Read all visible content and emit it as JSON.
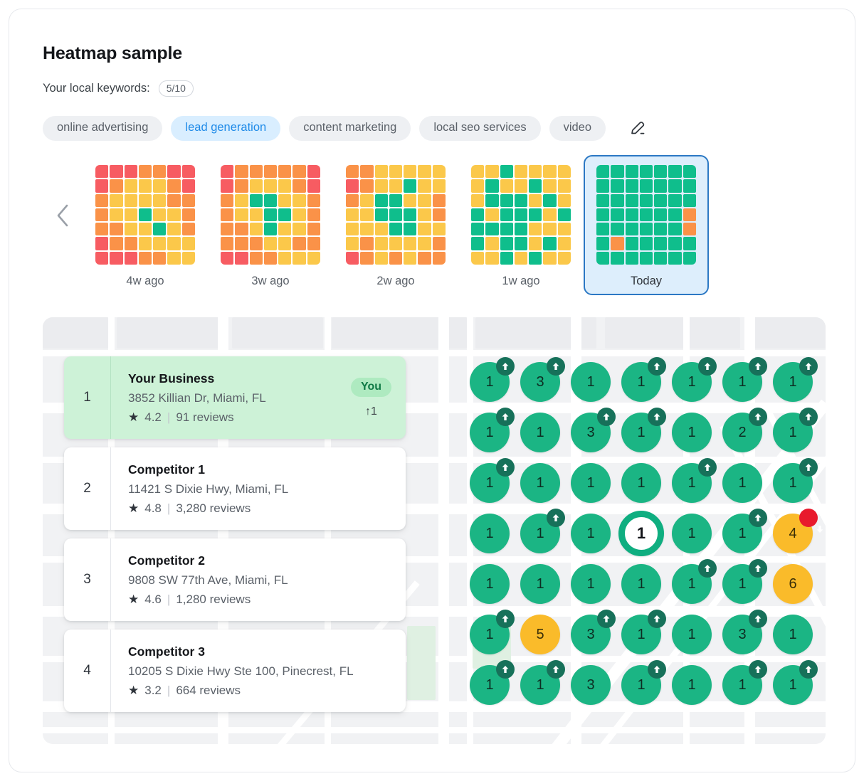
{
  "header": {
    "title": "Heatmap sample",
    "keywords_label": "Your local keywords:",
    "keywords_count": "5/10",
    "edit_icon": "pencil-icon"
  },
  "keywords": [
    {
      "label": "online advertising",
      "active": false
    },
    {
      "label": "lead generation",
      "active": true
    },
    {
      "label": "content marketing",
      "active": false
    },
    {
      "label": "local seo services",
      "active": false
    },
    {
      "label": "video",
      "active": false
    }
  ],
  "timeline": {
    "prev_icon": "chevron-left-icon",
    "snapshots": [
      {
        "label": "4w ago",
        "selected": false,
        "grid": [
          [
            "r",
            "r",
            "r",
            "o",
            "o",
            "r",
            "r"
          ],
          [
            "r",
            "o",
            "y",
            "y",
            "y",
            "o",
            "r"
          ],
          [
            "o",
            "y",
            "y",
            "y",
            "y",
            "o",
            "o"
          ],
          [
            "o",
            "y",
            "y",
            "g",
            "y",
            "y",
            "o"
          ],
          [
            "o",
            "o",
            "y",
            "y",
            "g",
            "y",
            "o"
          ],
          [
            "r",
            "o",
            "o",
            "y",
            "y",
            "y",
            "y"
          ],
          [
            "r",
            "r",
            "r",
            "o",
            "o",
            "y",
            "y"
          ]
        ]
      },
      {
        "label": "3w ago",
        "selected": false,
        "grid": [
          [
            "r",
            "o",
            "o",
            "o",
            "o",
            "o",
            "r"
          ],
          [
            "r",
            "o",
            "y",
            "y",
            "y",
            "o",
            "r"
          ],
          [
            "o",
            "y",
            "g",
            "g",
            "y",
            "y",
            "o"
          ],
          [
            "o",
            "y",
            "y",
            "g",
            "g",
            "y",
            "o"
          ],
          [
            "o",
            "o",
            "y",
            "g",
            "y",
            "y",
            "o"
          ],
          [
            "o",
            "o",
            "o",
            "y",
            "y",
            "o",
            "o"
          ],
          [
            "r",
            "r",
            "o",
            "o",
            "y",
            "y",
            "y"
          ]
        ]
      },
      {
        "label": "2w ago",
        "selected": false,
        "grid": [
          [
            "o",
            "o",
            "y",
            "y",
            "y",
            "y",
            "y"
          ],
          [
            "r",
            "o",
            "y",
            "y",
            "g",
            "y",
            "y"
          ],
          [
            "o",
            "y",
            "g",
            "g",
            "y",
            "y",
            "o"
          ],
          [
            "y",
            "y",
            "g",
            "g",
            "g",
            "y",
            "o"
          ],
          [
            "y",
            "y",
            "y",
            "g",
            "g",
            "y",
            "y"
          ],
          [
            "y",
            "o",
            "y",
            "y",
            "y",
            "y",
            "o"
          ],
          [
            "r",
            "o",
            "y",
            "o",
            "y",
            "o",
            "o"
          ]
        ]
      },
      {
        "label": "1w ago",
        "selected": false,
        "grid": [
          [
            "y",
            "y",
            "g",
            "y",
            "y",
            "y",
            "y"
          ],
          [
            "y",
            "g",
            "y",
            "y",
            "g",
            "y",
            "y"
          ],
          [
            "y",
            "g",
            "g",
            "g",
            "y",
            "g",
            "y"
          ],
          [
            "g",
            "y",
            "g",
            "g",
            "g",
            "y",
            "g"
          ],
          [
            "g",
            "g",
            "g",
            "g",
            "y",
            "y",
            "y"
          ],
          [
            "g",
            "y",
            "g",
            "g",
            "y",
            "g",
            "y"
          ],
          [
            "y",
            "y",
            "g",
            "y",
            "g",
            "y",
            "y"
          ]
        ]
      },
      {
        "label": "Today",
        "selected": true,
        "grid": [
          [
            "g",
            "g",
            "g",
            "g",
            "g",
            "g",
            "g"
          ],
          [
            "g",
            "g",
            "g",
            "g",
            "g",
            "g",
            "g"
          ],
          [
            "g",
            "g",
            "g",
            "g",
            "g",
            "g",
            "g"
          ],
          [
            "g",
            "g",
            "g",
            "g",
            "g",
            "g",
            "o"
          ],
          [
            "g",
            "g",
            "g",
            "g",
            "g",
            "g",
            "o"
          ],
          [
            "g",
            "o",
            "g",
            "g",
            "g",
            "g",
            "g"
          ],
          [
            "g",
            "g",
            "g",
            "g",
            "g",
            "g",
            "g"
          ]
        ]
      }
    ]
  },
  "colors": {
    "heat_red": "#f75c62",
    "heat_orange": "#fa9248",
    "heat_yellow": "#fbc84a",
    "heat_green": "#0fbe8c",
    "pin_green": "#1bb584",
    "pin_orange": "#fabb2a",
    "badge_up": "#17715a",
    "badge_down": "#e8192c",
    "you_card_bg": "#cdf2d7",
    "chip_active_bg": "#d9eeff",
    "chip_active_text": "#1e8ae8",
    "selected_border": "#2b78c4"
  },
  "businesses": [
    {
      "rank": "1",
      "name": "Your Business",
      "address": "3852 Killian Dr, Miami, FL",
      "rating": "4.2",
      "reviews": "91 reviews",
      "badge": "You",
      "delta": "↑1",
      "is_you": true
    },
    {
      "rank": "2",
      "name": "Competitor 1",
      "address": "11421 S Dixie Hwy, Miami, FL",
      "rating": "4.8",
      "reviews": "3,280 reviews",
      "badge": "",
      "delta": "",
      "is_you": false
    },
    {
      "rank": "3",
      "name": "Competitor 2",
      "address": "9808 SW 77th Ave, Miami, FL",
      "rating": "4.6",
      "reviews": "1,280 reviews",
      "badge": "",
      "delta": "",
      "is_you": false
    },
    {
      "rank": "4",
      "name": "Competitor 3",
      "address": "10205 S Dixie Hwy Ste 100, Pinecrest, FL",
      "rating": "3.2",
      "reviews": "664 reviews",
      "badge": "",
      "delta": "",
      "is_you": false
    }
  ],
  "map": {
    "star_glyph": "★",
    "separator": "|",
    "pin_grid": {
      "rows": 7,
      "cols": 7,
      "pins": [
        [
          {
            "value": "1",
            "color": "green",
            "trend": "up"
          },
          {
            "value": "3",
            "color": "green",
            "trend": "up"
          },
          {
            "value": "1",
            "color": "green",
            "trend": "none"
          },
          {
            "value": "1",
            "color": "green",
            "trend": "up"
          },
          {
            "value": "1",
            "color": "green",
            "trend": "up"
          },
          {
            "value": "1",
            "color": "green",
            "trend": "up"
          },
          {
            "value": "1",
            "color": "green",
            "trend": "up"
          }
        ],
        [
          {
            "value": "1",
            "color": "green",
            "trend": "up"
          },
          {
            "value": "1",
            "color": "green",
            "trend": "none"
          },
          {
            "value": "3",
            "color": "green",
            "trend": "up"
          },
          {
            "value": "1",
            "color": "green",
            "trend": "up"
          },
          {
            "value": "1",
            "color": "green",
            "trend": "none"
          },
          {
            "value": "2",
            "color": "green",
            "trend": "up"
          },
          {
            "value": "1",
            "color": "green",
            "trend": "up"
          }
        ],
        [
          {
            "value": "1",
            "color": "green",
            "trend": "up"
          },
          {
            "value": "1",
            "color": "green",
            "trend": "none"
          },
          {
            "value": "1",
            "color": "green",
            "trend": "none"
          },
          {
            "value": "1",
            "color": "green",
            "trend": "none"
          },
          {
            "value": "1",
            "color": "green",
            "trend": "up"
          },
          {
            "value": "1",
            "color": "green",
            "trend": "none"
          },
          {
            "value": "1",
            "color": "green",
            "trend": "up"
          }
        ],
        [
          {
            "value": "1",
            "color": "green",
            "trend": "none"
          },
          {
            "value": "1",
            "color": "green",
            "trend": "up"
          },
          {
            "value": "1",
            "color": "green",
            "trend": "none"
          },
          {
            "value": "1",
            "color": "you",
            "trend": "none"
          },
          {
            "value": "1",
            "color": "green",
            "trend": "none"
          },
          {
            "value": "1",
            "color": "green",
            "trend": "up"
          },
          {
            "value": "4",
            "color": "orange",
            "trend": "down"
          }
        ],
        [
          {
            "value": "1",
            "color": "green",
            "trend": "none"
          },
          {
            "value": "1",
            "color": "green",
            "trend": "none"
          },
          {
            "value": "1",
            "color": "green",
            "trend": "none"
          },
          {
            "value": "1",
            "color": "green",
            "trend": "none"
          },
          {
            "value": "1",
            "color": "green",
            "trend": "up"
          },
          {
            "value": "1",
            "color": "green",
            "trend": "up"
          },
          {
            "value": "6",
            "color": "orange",
            "trend": "none"
          }
        ],
        [
          {
            "value": "1",
            "color": "green",
            "trend": "up"
          },
          {
            "value": "5",
            "color": "orange",
            "trend": "none"
          },
          {
            "value": "3",
            "color": "green",
            "trend": "up"
          },
          {
            "value": "1",
            "color": "green",
            "trend": "up"
          },
          {
            "value": "1",
            "color": "green",
            "trend": "none"
          },
          {
            "value": "3",
            "color": "green",
            "trend": "up"
          },
          {
            "value": "1",
            "color": "green",
            "trend": "none"
          }
        ],
        [
          {
            "value": "1",
            "color": "green",
            "trend": "up"
          },
          {
            "value": "1",
            "color": "green",
            "trend": "up"
          },
          {
            "value": "3",
            "color": "green",
            "trend": "none"
          },
          {
            "value": "1",
            "color": "green",
            "trend": "up"
          },
          {
            "value": "1",
            "color": "green",
            "trend": "none"
          },
          {
            "value": "1",
            "color": "green",
            "trend": "up"
          },
          {
            "value": "1",
            "color": "green",
            "trend": "up"
          }
        ]
      ]
    }
  }
}
